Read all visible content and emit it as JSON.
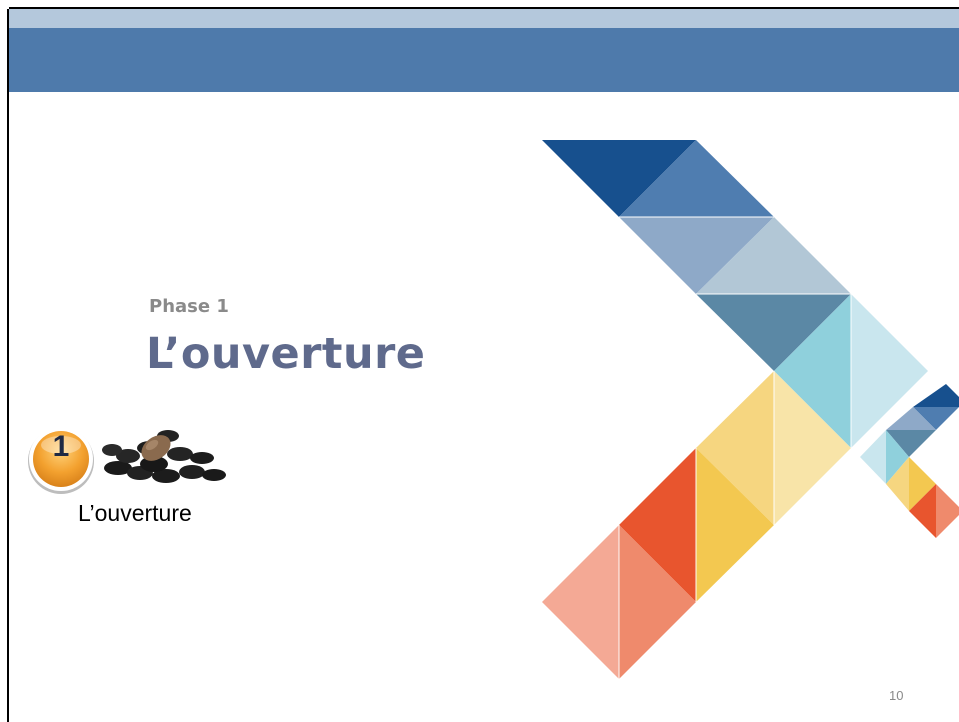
{
  "slide": {
    "subtitle": "Phase 1",
    "title": "L’ouverture",
    "badge_number": "1",
    "phase_label": "L’ouverture",
    "page_number": "10"
  },
  "colors": {
    "header_band_light": "#b4c8dc",
    "header_band_dark": "#4e7aab",
    "title_text": "#5f6a8c",
    "subtitle_text": "#8a8a8a",
    "badge_orange": "#f0a030"
  },
  "icons": {
    "badge": "numbered-orange-circle-icon",
    "seeds": "seed-pile-icon",
    "decoration": "triangle-mosaic-arrow"
  }
}
